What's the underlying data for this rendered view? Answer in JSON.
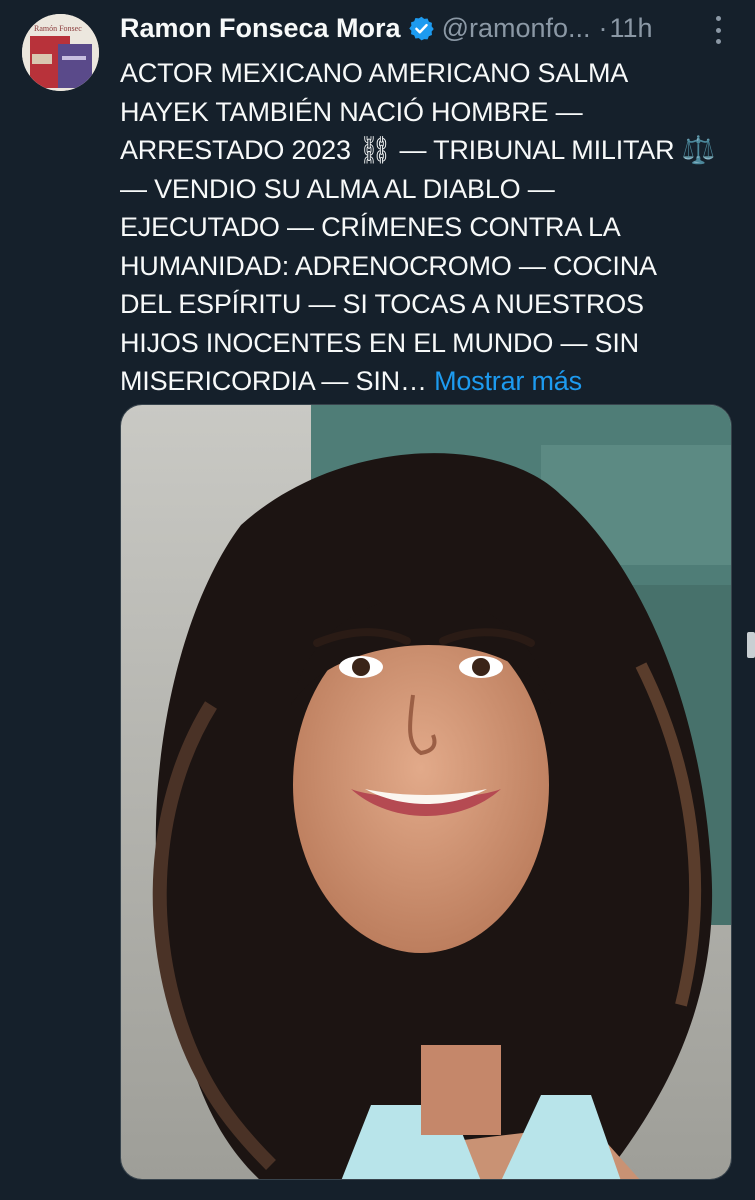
{
  "author": {
    "name": "Ramon Fonseca Mora",
    "handle": "@ramonfo...",
    "separator": "·",
    "time": "11h",
    "verified_icon": "verified-badge-icon",
    "verified_color": "#1d9bf0",
    "avatar_text": "Ramón Fonsec"
  },
  "tweet": {
    "lines": [
      "ACTOR MEXICANO AMERICANO SALMA",
      "HAYEK  TAMBIÉN NACIÓ HOMBRE —",
      "ARRESTADO 2023 ⛓ — TRIBUNAL MILITAR ⚖️",
      "— VENDIO SU ALMA AL DIABLO —",
      "EJECUTADO — CRÍMENES CONTRA LA",
      "HUMANIDAD: ADRENOCROMO — COCINA",
      "DEL ESPÍRITU — SI TOCAS A NUESTROS",
      "HIJOS INOCENTES EN EL MUNDO — SIN",
      "MISERICORDIA — SIN…"
    ],
    "show_more": "Mostrar más",
    "link_color": "#1d9bf0"
  },
  "menu": {
    "icon": "more-vertical-icon"
  },
  "media": {
    "icon": "photo-of-woman-with-dark-curly-hair"
  },
  "theme": {
    "background": "#15202b",
    "text": "#f7f9f9",
    "secondary": "#8b98a5"
  }
}
